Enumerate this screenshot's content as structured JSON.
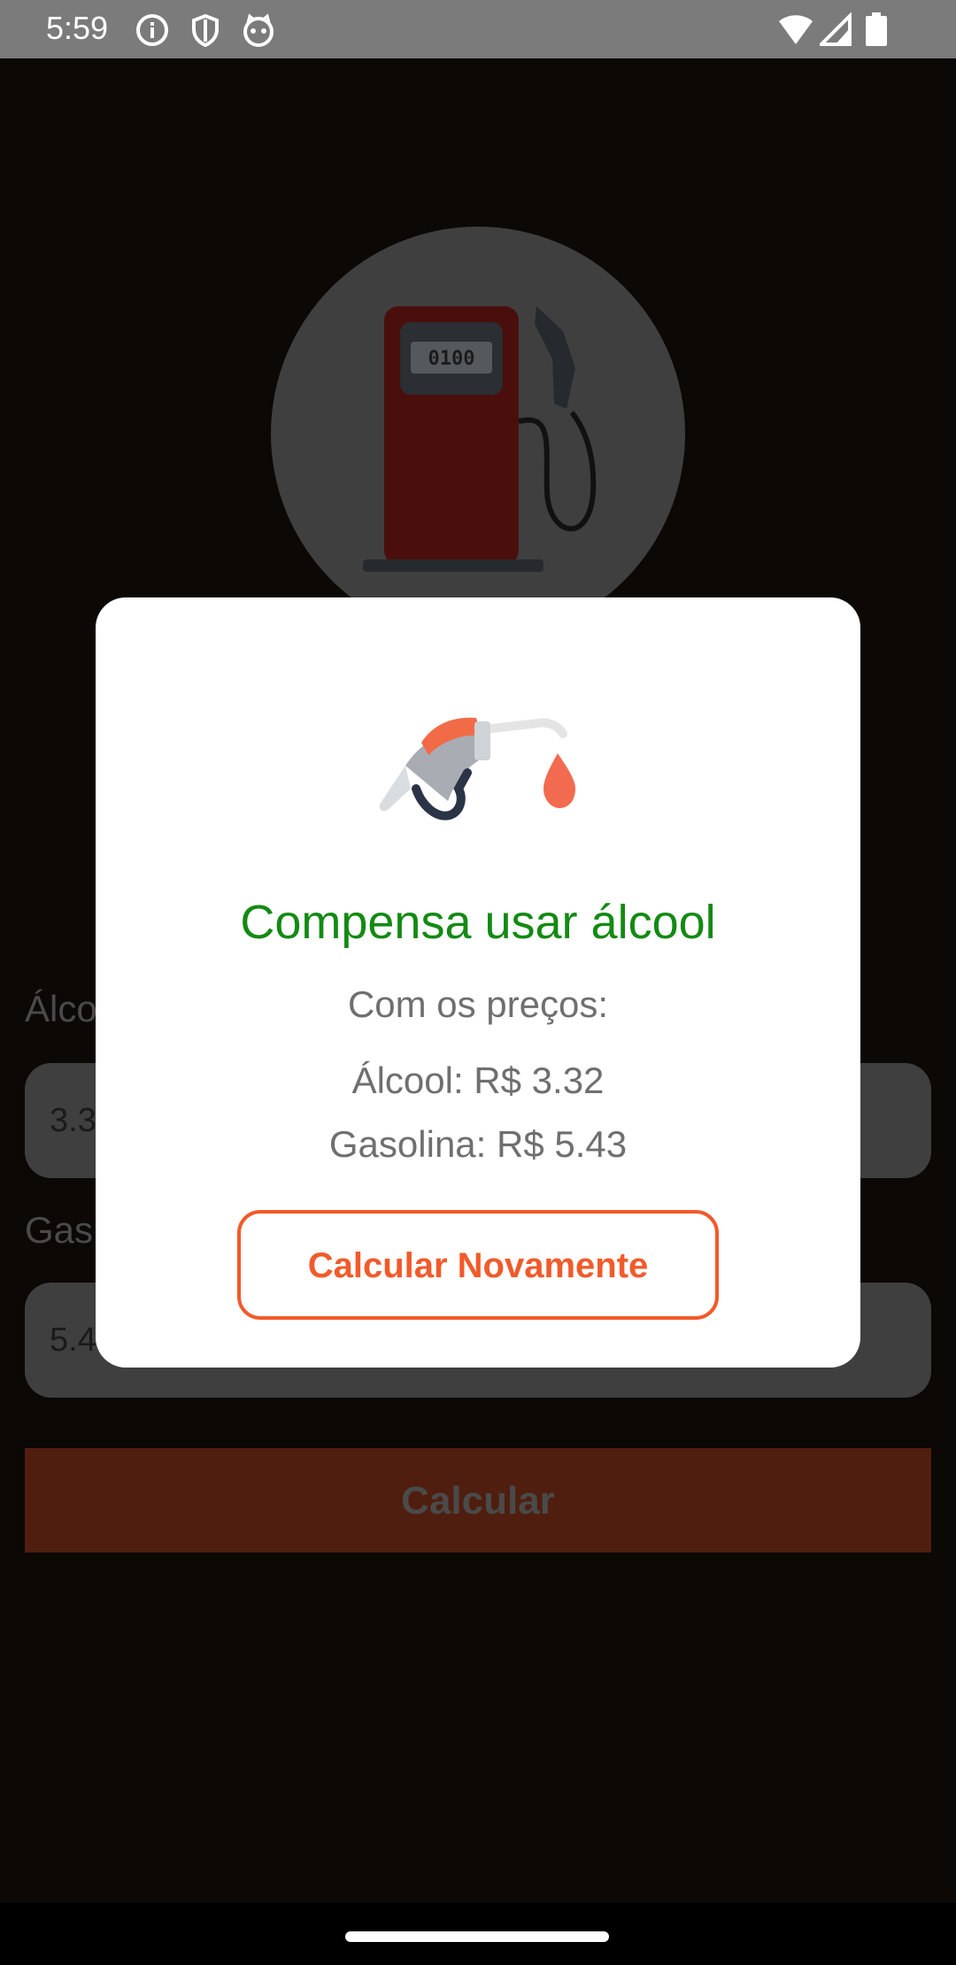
{
  "status_bar": {
    "time": "5:59",
    "icons": [
      "info-icon",
      "shield-icon",
      "cat-face-icon",
      "wifi-icon",
      "signal-icon",
      "battery-icon"
    ]
  },
  "app": {
    "logo": "fuel-pump-logo",
    "pump_counter": "0100",
    "alcohol_label": "Álcool",
    "alcohol_value": "3.3",
    "gasoline_label": "Gas",
    "gasoline_value": "5.4",
    "calculate_label": "Calcular"
  },
  "dialog": {
    "icon": "fuel-nozzle-drop-icon",
    "title": "Compensa usar álcool",
    "subtitle": "Com os preços:",
    "alcohol_line": "Álcool: R$ 3.32",
    "gasoline_line": "Gasolina: R$ 5.43",
    "button_label": "Calcular Novamente"
  },
  "colors": {
    "title_green": "#138a13",
    "accent_orange": "#f25a2a",
    "scrim": "#0b0806"
  }
}
